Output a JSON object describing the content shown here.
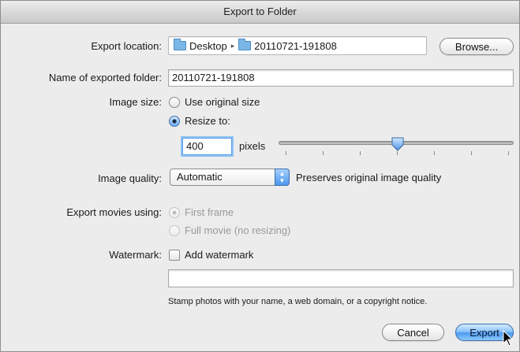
{
  "window": {
    "title": "Export to Folder"
  },
  "export_location": {
    "label": "Export location:",
    "path": [
      "Desktop",
      "20110721-191808"
    ],
    "browse_label": "Browse..."
  },
  "folder_name": {
    "label": "Name of exported folder:",
    "value": "20110721-191808"
  },
  "image_size": {
    "label": "Image size:",
    "option_original": "Use original size",
    "option_resize": "Resize to:",
    "selected": "Resize to:",
    "pixels_value": "400",
    "pixels_unit": "pixels",
    "slider_fraction": 0.5
  },
  "image_quality": {
    "label": "Image quality:",
    "selected": "Automatic",
    "note": "Preserves original image quality"
  },
  "export_movies": {
    "label": "Export movies using:",
    "option_first": "First frame",
    "option_full": "Full movie (no resizing)",
    "selected": "First frame",
    "enabled": false
  },
  "watermark": {
    "label": "Watermark:",
    "checkbox_label": "Add watermark",
    "checked": false,
    "text_value": "",
    "hint": "Stamp photos with your name, a web domain, or a copyright notice."
  },
  "buttons": {
    "cancel": "Cancel",
    "export": "Export"
  },
  "colors": {
    "accent": "#4e9cf0",
    "window_bg": "#ececec",
    "disabled_text": "#9a9a9a"
  }
}
